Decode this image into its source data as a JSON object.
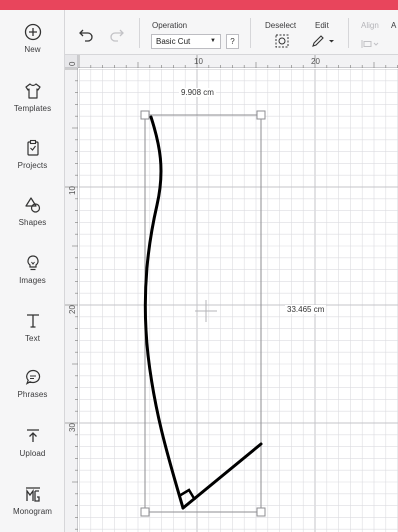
{
  "sidebar": {
    "items": [
      {
        "label": "New",
        "icon": "plus-circle-icon"
      },
      {
        "label": "Templates",
        "icon": "shirt-icon"
      },
      {
        "label": "Projects",
        "icon": "clipboard-icon"
      },
      {
        "label": "Shapes",
        "icon": "shapes-icon"
      },
      {
        "label": "Images",
        "icon": "lightbulb-icon"
      },
      {
        "label": "Text",
        "icon": "text-icon"
      },
      {
        "label": "Phrases",
        "icon": "speech-bubble-icon"
      },
      {
        "label": "Upload",
        "icon": "upload-icon"
      },
      {
        "label": "Monogram",
        "icon": "monogram-icon"
      }
    ]
  },
  "toolbar": {
    "undo_icon": "undo-icon",
    "redo_icon": "redo-icon",
    "operation_label": "Operation",
    "operation_value": "Basic Cut",
    "operation_help": "?",
    "deselect_label": "Deselect",
    "deselect_icon": "deselect-icon",
    "edit_label": "Edit",
    "edit_icon": "pen-icon",
    "align_label": "Align",
    "arrange_label_fragment": "A",
    "align_icon": "align-icon"
  },
  "canvas": {
    "ruler_top_numbers": [
      "0",
      "10",
      "20"
    ],
    "ruler_left_numbers": [
      "0",
      "10",
      "20",
      "30"
    ],
    "width_label": "9.908 cm",
    "height_label": "33.465 cm"
  },
  "colors": {
    "brand": "#e8455c",
    "sidebar_bg": "#f6f6f7",
    "grid_line": "#dcdce0",
    "grid_major": "#c4c4c9",
    "selection": "#9a9a9e",
    "shape_stroke": "#000000"
  }
}
